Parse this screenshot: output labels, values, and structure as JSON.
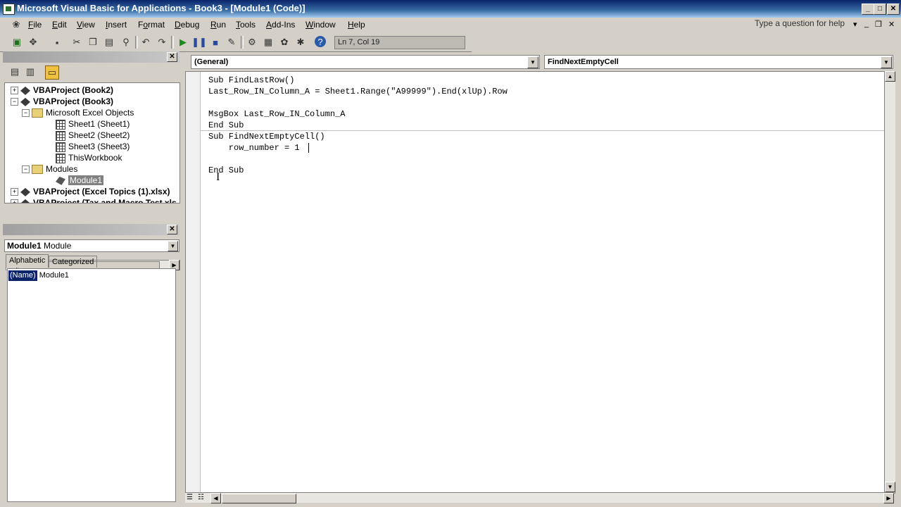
{
  "window": {
    "title": "Microsoft Visual Basic for Applications - Book3 - [Module1 (Code)]",
    "controls": {
      "minimize": "_",
      "maximize": "□",
      "close": "✕"
    }
  },
  "menubar": {
    "items": [
      {
        "pre": "",
        "u": "F",
        "post": "ile"
      },
      {
        "pre": "",
        "u": "E",
        "post": "dit"
      },
      {
        "pre": "",
        "u": "V",
        "post": "iew"
      },
      {
        "pre": "",
        "u": "I",
        "post": "nsert"
      },
      {
        "pre": "F",
        "u": "o",
        "post": "rmat"
      },
      {
        "pre": "",
        "u": "D",
        "post": "ebug"
      },
      {
        "pre": "",
        "u": "R",
        "post": "un"
      },
      {
        "pre": "",
        "u": "T",
        "post": "ools"
      },
      {
        "pre": "",
        "u": "A",
        "post": "dd-Ins"
      },
      {
        "pre": "",
        "u": "W",
        "post": "indow"
      },
      {
        "pre": "",
        "u": "H",
        "post": "elp"
      }
    ],
    "help_placeholder": "Type a question for help"
  },
  "toolbar": {
    "status": "Ln 7, Col 19"
  },
  "project_explorer": {
    "nodes": [
      {
        "label": "VBAProject (Book2)",
        "type": "project",
        "expander": "+"
      },
      {
        "label": "VBAProject (Book3)",
        "type": "project",
        "expander": "−"
      },
      {
        "label": "Microsoft Excel Objects",
        "type": "folder",
        "expander": "−"
      },
      {
        "label": "Sheet1 (Sheet1)",
        "type": "sheet"
      },
      {
        "label": "Sheet2 (Sheet2)",
        "type": "sheet"
      },
      {
        "label": "Sheet3 (Sheet3)",
        "type": "sheet"
      },
      {
        "label": "ThisWorkbook",
        "type": "workbook"
      },
      {
        "label": "Modules",
        "type": "folder",
        "expander": "−"
      },
      {
        "label": "Module1",
        "type": "module"
      },
      {
        "label": "VBAProject (Excel Topics (1).xlsx)",
        "type": "project",
        "expander": "+"
      },
      {
        "label": "VBAProject (Tax and Macro Test.xls",
        "type": "project",
        "expander": "+"
      }
    ]
  },
  "properties": {
    "object_name": "Module1",
    "object_type": "Module",
    "tabs": [
      "Alphabetic",
      "Categorized"
    ],
    "rows": [
      {
        "name": "(Name)",
        "value": "Module1"
      }
    ]
  },
  "code": {
    "object_combo": "(General)",
    "proc_combo": "FindNextEmptyCell",
    "lines": [
      "Sub FindLastRow()",
      "Last_Row_IN_Column_A = Sheet1.Range(\"A99999\").End(xlUp).Row",
      "",
      "MsgBox Last_Row_IN_Column_A",
      "End Sub",
      "Sub FindNextEmptyCell()",
      "    row_number = 1",
      "",
      "End Sub"
    ]
  }
}
